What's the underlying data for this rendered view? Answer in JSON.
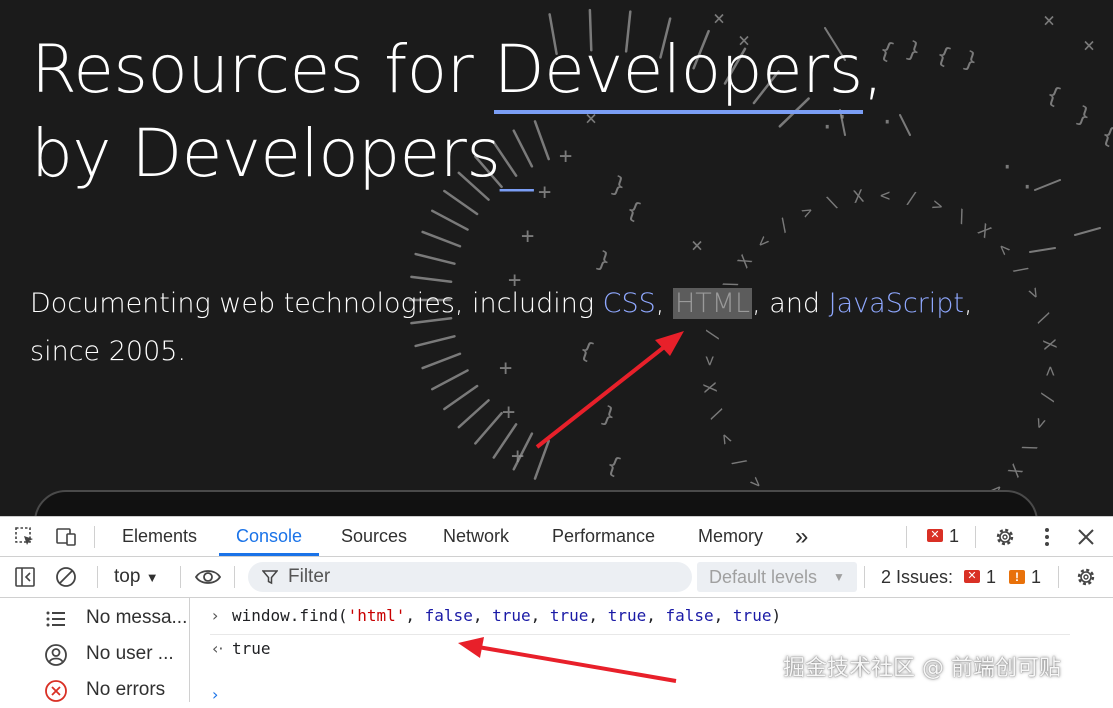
{
  "hero": {
    "headline_1_prefix": "Resources for ",
    "headline_1_link": "Developers",
    "headline_1_suffix": ",",
    "headline_2": "by Developers",
    "headline_cursor": "_",
    "sub_prefix": "Documenting web technologies, including ",
    "sub_css": "CSS",
    "sub_comma1": ", ",
    "sub_html": "HTML",
    "sub_and": ", and ",
    "sub_js": "JavaScript",
    "sub_suffix": ", since 2005."
  },
  "devtools": {
    "tabs": [
      "Elements",
      "Console",
      "Sources",
      "Network",
      "Performance",
      "Memory"
    ],
    "active_tab": "Console",
    "more_tabs_glyph": "»",
    "error_count": "1",
    "context": "top",
    "filter_placeholder": "Filter",
    "levels": "Default levels",
    "issues_label": "2 Issues:",
    "issues_error_count": "1",
    "issues_warning_count": "1",
    "sidebar": [
      "No messa...",
      "No user ...",
      "No errors"
    ],
    "console": {
      "input_fn": "window.find(",
      "input_str": "'html'",
      "input_args": [
        "false",
        "true",
        "true",
        "true",
        "false",
        "true"
      ],
      "input_close": ")",
      "output": "true"
    }
  },
  "watermark": "掘金技术社区 @ 前端创可贴",
  "colors": {
    "hero_bg": "#1b1b1b",
    "link_blue": "#8fa8ff",
    "active_tab": "#1a73e8",
    "error_red": "#d93025",
    "warning_orange": "#e8710a",
    "annotation_arrow": "#e8202a"
  }
}
